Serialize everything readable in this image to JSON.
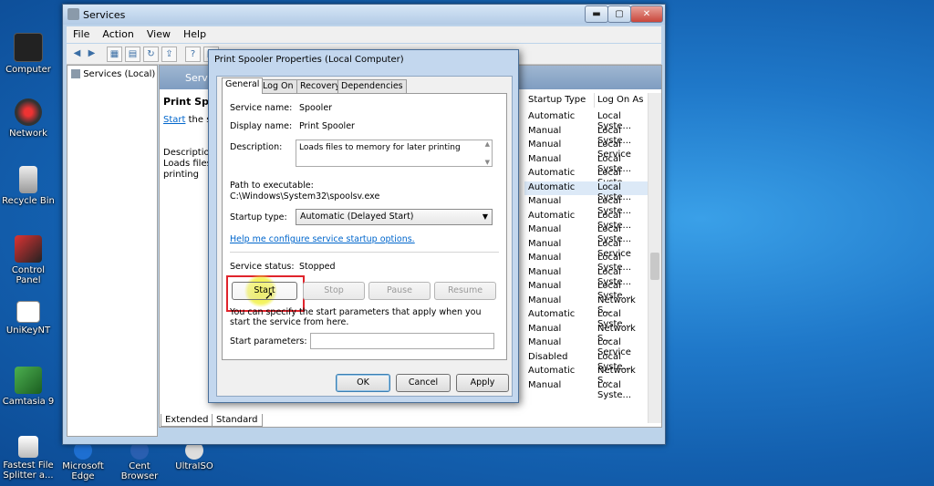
{
  "desktop": {
    "icons": [
      {
        "label": "Computer"
      },
      {
        "label": "Network"
      },
      {
        "label": "Recycle Bin"
      },
      {
        "label": "Control Panel"
      },
      {
        "label": "UniKeyNT"
      },
      {
        "label": "Camtasia 9"
      },
      {
        "label": "Fastest File Splitter a..."
      }
    ],
    "bottom_icons": [
      {
        "label": "Microsoft Edge"
      },
      {
        "label": "Cent Browser"
      },
      {
        "label": "UltraISO"
      }
    ]
  },
  "services_window": {
    "title": "Services",
    "caption_buttons": {
      "minimize": "▬",
      "maximize": "▢",
      "close": "✕"
    },
    "menu": [
      "File",
      "Action",
      "View",
      "Help"
    ],
    "tree_node": "Services (Local)",
    "header": "Servic",
    "desc": {
      "title": "Print Spool",
      "start_link": "Start",
      "start_suffix": " the se",
      "line1": "Description",
      "line2": "Loads files t",
      "line3": "printing"
    },
    "columns": {
      "startup_type": "Startup Type",
      "log_on_as": "Log On As"
    },
    "rows": [
      {
        "startup": "Automatic",
        "logon": "Local Syste..."
      },
      {
        "startup": "Manual",
        "logon": "Local Syste..."
      },
      {
        "startup": "Manual",
        "logon": "Local Service"
      },
      {
        "startup": "Manual",
        "logon": "Local Syste..."
      },
      {
        "startup": "Automatic",
        "logon": "Local Syste..."
      },
      {
        "startup": "Automatic",
        "logon": "Local Syste..."
      },
      {
        "startup": "Manual",
        "logon": "Local Syste..."
      },
      {
        "startup": "Automatic",
        "logon": "Local Syste..."
      },
      {
        "startup": "Manual",
        "logon": "Local Syste..."
      },
      {
        "startup": "Manual",
        "logon": "Local Service"
      },
      {
        "startup": "Manual",
        "logon": "Local Syste..."
      },
      {
        "startup": "Manual",
        "logon": "Local Syste..."
      },
      {
        "startup": "Manual",
        "logon": "Local Syste..."
      },
      {
        "startup": "Manual",
        "logon": "Network S..."
      },
      {
        "startup": "Automatic",
        "logon": "Local Syste..."
      },
      {
        "startup": "Manual",
        "logon": "Network S..."
      },
      {
        "startup": "Manual",
        "logon": "Local Service"
      },
      {
        "startup": "Disabled",
        "logon": "Local Syste..."
      },
      {
        "startup": "Automatic",
        "logon": "Network S..."
      },
      {
        "startup": "Manual",
        "logon": "Local Syste..."
      }
    ],
    "bottom_tabs": [
      "Extended",
      "Standard"
    ]
  },
  "dialog": {
    "title": "Print Spooler Properties (Local Computer)",
    "tabs": [
      "General",
      "Log On",
      "Recovery",
      "Dependencies"
    ],
    "service_name_label": "Service name:",
    "service_name": "Spooler",
    "display_name_label": "Display name:",
    "display_name": "Print Spooler",
    "description_label": "Description:",
    "description": "Loads files to memory for later printing",
    "path_label": "Path to executable:",
    "path": "C:\\Windows\\System32\\spoolsv.exe",
    "startup_type_label": "Startup type:",
    "startup_type": "Automatic (Delayed Start)",
    "help_link": "Help me configure service startup options.",
    "status_label": "Service status:",
    "status": "Stopped",
    "buttons": {
      "start": "Start",
      "stop": "Stop",
      "pause": "Pause",
      "resume": "Resume"
    },
    "hint": "You can specify the start parameters that apply when you start the service from here.",
    "start_params_label": "Start parameters:",
    "ok": "OK",
    "cancel": "Cancel",
    "apply": "Apply"
  },
  "colors": {
    "highlight": "#e0242c",
    "accent": "#0066cc"
  }
}
